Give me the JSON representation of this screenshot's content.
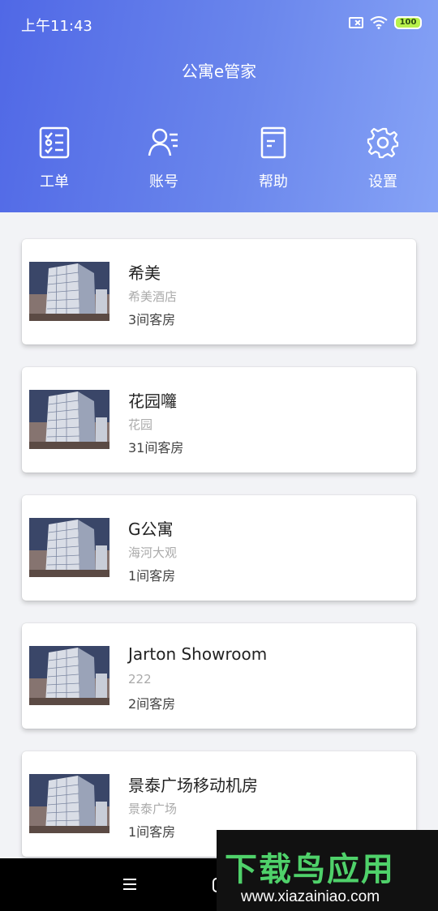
{
  "status_bar": {
    "time": "上午11:43",
    "battery": "100"
  },
  "header": {
    "title": "公寓e管家"
  },
  "nav": [
    {
      "label": "工单",
      "icon": "work-order-icon"
    },
    {
      "label": "账号",
      "icon": "account-icon"
    },
    {
      "label": "帮助",
      "icon": "help-book-icon"
    },
    {
      "label": "设置",
      "icon": "gear-icon"
    }
  ],
  "properties": [
    {
      "name": "希美",
      "subtitle": "希美酒店",
      "rooms": "3间客房"
    },
    {
      "name": "花园囖",
      "subtitle": "花园",
      "rooms": "31间客房"
    },
    {
      "name": "G公寓",
      "subtitle": "海河大观",
      "rooms": "1间客房"
    },
    {
      "name": "Jarton Showroom",
      "subtitle": "222",
      "rooms": "2间客房"
    },
    {
      "name": "景泰广场移动机房",
      "subtitle": "景泰广场",
      "rooms": "1间客房"
    }
  ],
  "watermark": {
    "title": "下载鸟应用",
    "url": "www.xiazainiao.com"
  },
  "colors": {
    "header_start": "#5068e6",
    "header_end": "#86a3f6",
    "background": "#f2f3f6"
  }
}
